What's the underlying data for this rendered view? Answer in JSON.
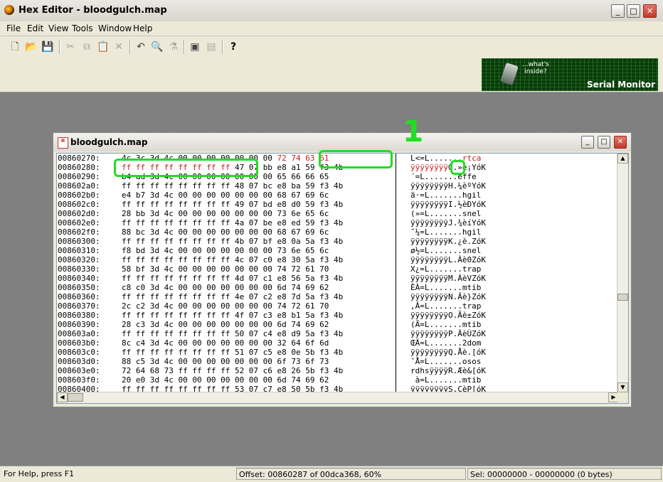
{
  "window": {
    "title": "Hex Editor - bloodgulch.map"
  },
  "menu": [
    "File",
    "Edit",
    "View",
    "Tools",
    "Window",
    "Help"
  ],
  "toolbar": {
    "buttons": [
      {
        "name": "new-icon",
        "glyph": "🗋",
        "enabled": true
      },
      {
        "name": "open-icon",
        "glyph": "📂",
        "enabled": true
      },
      {
        "name": "save-icon",
        "glyph": "💾",
        "enabled": true
      },
      {
        "name": "cut-icon",
        "glyph": "✂",
        "enabled": false
      },
      {
        "name": "copy-icon",
        "glyph": "⧉",
        "enabled": false
      },
      {
        "name": "paste-icon",
        "glyph": "📋",
        "enabled": false
      },
      {
        "name": "delete-icon",
        "glyph": "✕",
        "enabled": false
      },
      {
        "name": "undo-icon",
        "glyph": "↶",
        "enabled": true
      },
      {
        "name": "find-icon",
        "glyph": "🔍",
        "enabled": true
      },
      {
        "name": "replace-icon",
        "glyph": "⚗",
        "enabled": false
      },
      {
        "name": "window-icon",
        "glyph": "▣",
        "enabled": true
      },
      {
        "name": "window-2-icon",
        "glyph": "▤",
        "enabled": false
      },
      {
        "name": "help-icon",
        "glyph": "?",
        "enabled": true
      }
    ]
  },
  "banner": {
    "tagline": "...what's\ninside?",
    "title": "Serial Monitor"
  },
  "document": {
    "title": "bloodgulch.map"
  },
  "annotation": {
    "label": "1"
  },
  "rows": [
    {
      "offset": "00860270:",
      "hex": "4c 3c 3d 4c 00 00 00 00 00 00 00 ",
      "hex_red": "72 74 63 61",
      "ascii": "L<=L.......",
      "ascii_red": "rtca"
    },
    {
      "offset": "00860280:",
      "hex_red": "ff ff ff ff ff ff ff ff ",
      "hex": "47 07 bb e8 a1 59 f3 4b",
      "ascii_red": "ÿÿÿÿÿÿÿÿ",
      "ascii": "G.»è¡YóK"
    },
    {
      "offset": "00860290:",
      "hex": "b4 ad 3d 4c 00 00 00 00 00 00 00 65 66 66 65",
      "ascii": "´­=L.......effe"
    },
    {
      "offset": "008602a0:",
      "hex": "ff ff ff ff ff ff ff ff 48 07 bc e8 ba 59 f3 4b",
      "ascii": "ÿÿÿÿÿÿÿÿH.¼èºYóK"
    },
    {
      "offset": "008602b0:",
      "hex": "e4 b7 3d 4c 00 00 00 00 00 00 00 68 67 69 6c",
      "ascii": "ä·=L.......hgil"
    },
    {
      "offset": "008602c0:",
      "hex": "ff ff ff ff ff ff ff ff 49 07 bd e8 d0 59 f3 4b",
      "ascii": "ÿÿÿÿÿÿÿÿI.½èÐYóK"
    },
    {
      "offset": "008602d0:",
      "hex": "28 bb 3d 4c 00 00 00 00 00 00 00 73 6e 65 6c",
      "ascii": "(»=L.......snel"
    },
    {
      "offset": "008602e0:",
      "hex": "ff ff ff ff ff ff ff ff 4a 07 be e8 ed 59 f3 4b",
      "ascii": "ÿÿÿÿÿÿÿÿJ.¾èíYóK"
    },
    {
      "offset": "008602f0:",
      "hex": "88 bc 3d 4c 00 00 00 00 00 00 00 68 67 69 6c",
      "ascii": "ˆ¼=L.......hgil"
    },
    {
      "offset": "00860300:",
      "hex": "ff ff ff ff ff ff ff ff 4b 07 bf e8 0a 5a f3 4b",
      "ascii": "ÿÿÿÿÿÿÿÿK.¿è.ZóK"
    },
    {
      "offset": "00860310:",
      "hex": "f8 bd 3d 4c 00 00 00 00 00 00 00 73 6e 65 6c",
      "ascii": "ø½=L.......snel"
    },
    {
      "offset": "00860320:",
      "hex": "ff ff ff ff ff ff ff ff 4c 07 c0 e8 30 5a f3 4b",
      "ascii": "ÿÿÿÿÿÿÿÿL.Àè0ZóK"
    },
    {
      "offset": "00860330:",
      "hex": "58 bf 3d 4c 00 00 00 00 00 00 00 74 72 61 70",
      "ascii": "X¿=L.......trap"
    },
    {
      "offset": "00860340:",
      "hex": "ff ff ff ff ff ff ff ff 4d 07 c1 e8 56 5a f3 4b",
      "ascii": "ÿÿÿÿÿÿÿÿM.ÁèVZóK"
    },
    {
      "offset": "00860350:",
      "hex": "c8 c0 3d 4c 00 00 00 00 00 00 00 6d 74 69 62",
      "ascii": "ÈÀ=L.......mtib"
    },
    {
      "offset": "00860360:",
      "hex": "ff ff ff ff ff ff ff ff 4e 07 c2 e8 7d 5a f3 4b",
      "ascii": "ÿÿÿÿÿÿÿÿN.Âè}ZóK"
    },
    {
      "offset": "00860370:",
      "hex": "2c c2 3d 4c 00 00 00 00 00 00 00 74 72 61 70",
      "ascii": ",Â=L.......trap"
    },
    {
      "offset": "00860380:",
      "hex": "ff ff ff ff ff ff ff ff 4f 07 c3 e8 b1 5a f3 4b",
      "ascii": "ÿÿÿÿÿÿÿÿO.Ãè±ZóK"
    },
    {
      "offset": "00860390:",
      "hex": "28 c3 3d 4c 00 00 00 00 00 00 00 6d 74 69 62",
      "ascii": "(Ã=L.......mtib"
    },
    {
      "offset": "008603a0:",
      "hex": "ff ff ff ff ff ff ff ff 50 07 c4 e8 d9 5a f3 4b",
      "ascii": "ÿÿÿÿÿÿÿÿP.ÄèÙZóK"
    },
    {
      "offset": "008603b0:",
      "hex": "8c c4 3d 4c 00 00 00 00 00 00 00 32 64 6f 6d",
      "ascii": "ŒÄ=L.......2dom"
    },
    {
      "offset": "008603c0:",
      "hex": "ff ff ff ff ff ff ff ff 51 07 c5 e8 0e 5b f3 4b",
      "ascii": "ÿÿÿÿÿÿÿÿQ.Åè.[óK"
    },
    {
      "offset": "008603d0:",
      "hex": "88 c5 3d 4c 00 00 00 00 00 00 00 6f 73 6f 73",
      "ascii": "ˆÅ=L.......osos"
    },
    {
      "offset": "008603e0:",
      "hex": "72 64 68 73 ff ff ff ff 52 07 c6 e8 26 5b f3 4b",
      "ascii": "rdhsÿÿÿÿR.Æè&[óK"
    },
    {
      "offset": "008603f0:",
      "hex": "20 e0 3d 4c 00 00 00 00 00 00 00 6d 74 69 62",
      "ascii": " à=L.......mtib"
    },
    {
      "offset": "00860400:",
      "hex": "ff ff ff ff ff ff ff ff 53 07 c7 e8 50 5b f3 4b",
      "ascii": "ÿÿÿÿÿÿÿÿS.ÇèP[óK"
    }
  ],
  "status": {
    "help": "For Help, press F1",
    "offset": "Offset: 00860287 of 00dca368, 60%",
    "selection": "Sel: 00000000 - 00000000 (0 bytes)"
  },
  "colors": {
    "highlight": "#22dd22",
    "changed_bytes": "#c41e1e"
  }
}
